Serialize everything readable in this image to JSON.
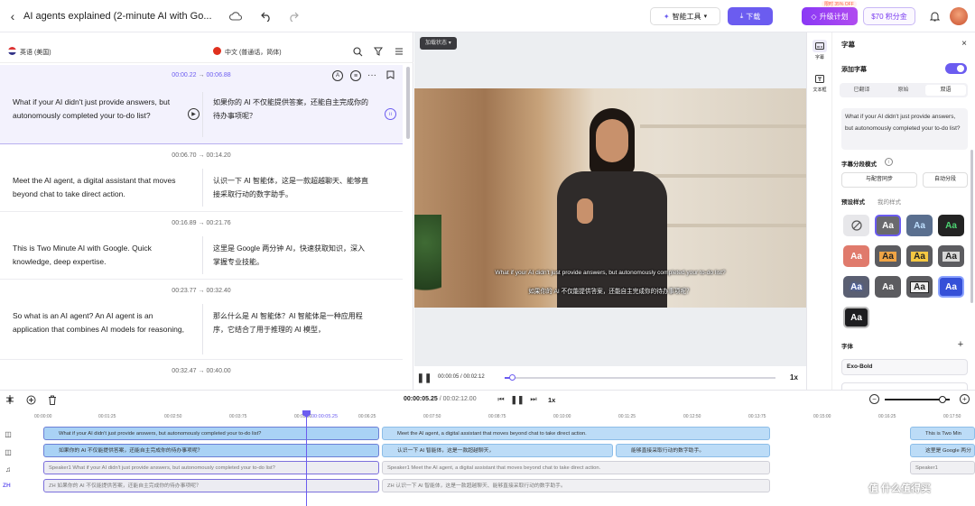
{
  "header": {
    "title": "AI agents explained (2-minute AI with Go...",
    "smart_tools": "智能工具",
    "download": "下载",
    "promo_badge": "限时 35% OFF",
    "upgrade": "升级计划",
    "credits": "$70 积分金"
  },
  "languages": {
    "source": "英语 (美国)",
    "target": "中文 (普通话，简体)"
  },
  "segments": [
    {
      "time_start": "00:00.22",
      "time_end": "00:06.88",
      "en": "What if your AI didn't just provide answers, but autonomously completed your to-do list?",
      "zh": "如果你的 AI 不仅能提供答案，还能自主完成你的待办事项呢？"
    },
    {
      "time_start": "00:06.70",
      "time_end": "00:14.20",
      "en": "Meet the AI agent, a digital assistant that moves beyond chat to take direct action.",
      "zh": "认识一下 AI 智能体，这是一款超越聊天、能够直接采取行动的数字助手。"
    },
    {
      "time_start": "00:16.89",
      "time_end": "00:21.76",
      "en": "This is Two Minute AI with Google. Quick knowledge, deep expertise.",
      "zh": "这里是 Google 两分钟 AI，快速获取知识，深入掌握专业技能。"
    },
    {
      "time_start": "00:23.77",
      "time_end": "00:32.40",
      "en": "So what is an AI agent? An AI agent is an application that combines AI models for reasoning,",
      "zh": "那么什么是 AI 智能体？AI 智能体是一种应用程序，它结合了用于推理的 AI 模型，"
    },
    {
      "time_start": "00:32.47",
      "time_end": "00:40.00",
      "en": "",
      "zh": ""
    }
  ],
  "video": {
    "status": "加载状态",
    "subtitle_en": "What if your AI didn't just provide answers, but autonomously completed your to-do list?",
    "subtitle_zh": "如果你的 AI 不仅能提供答案，还能自主完成你的待办事项呢？",
    "time_current": "00:00:05",
    "time_total": "00:02:12",
    "speed": "1x"
  },
  "rail": {
    "subtitles": "字幕",
    "text": "文本框"
  },
  "panel": {
    "title": "字幕",
    "add_subtitles": "添加字幕",
    "tabs": [
      "已翻译",
      "原始",
      "双语"
    ],
    "preview": "What if your AI didn't just provide answers, but autonomously completed your to-do list?",
    "split_mode_label": "字幕分段模式",
    "split_options": [
      "与配音同步",
      "自动分段"
    ],
    "style_tabs": [
      "预设样式",
      "我的样式"
    ],
    "style_tile_text": "Aa",
    "font_label": "字体",
    "font_value": "Exo-Bold"
  },
  "timeline": {
    "time_current": "00:00:05.25",
    "time_total": "00:02:12.00",
    "speed": "1x",
    "playhead_label": "00:00:05.25",
    "ruler": [
      "00:00:00",
      "00:01:25",
      "00:02:50",
      "00:03:75",
      "00:05:00",
      "00:06:25",
      "00:07:50",
      "00:08:75",
      "00:10:00",
      "00:11:25",
      "00:12:50",
      "00:13:75",
      "00:15:00",
      "00:16:25",
      "00:17:50"
    ],
    "track_zh_label": "ZH",
    "row1": [
      "What if your AI didn't just provide answers, but autonomously completed your to-do list?",
      "Meet the AI agent, a digital assistant that moves beyond chat to take direct action.",
      "This is Two Min"
    ],
    "row2": [
      "如果你的 AI 不仅能提供答案，还能自主完成你的待办事项呢？",
      "认识一下 AI 智能体，这是一款超越聊天，",
      "能够直接采取行动的数字助手。",
      "这里是 Google 两分"
    ],
    "row3": [
      "Speaker1  What if your AI didn't just provide answers, but autonomously completed your to-do list?",
      "Speaker1  Meet the AI agent, a digital assistant that moves beyond chat to take direct action.",
      "Speaker1"
    ],
    "row4": [
      "ZH  如果你的 AI 不仅能提供答案，还能自主完成你的待办事项呢？",
      "ZH  认识一下 AI 智能体，这是一款超越聊天、能够直接采取行动的数字助手。"
    ]
  },
  "watermark": "值 什么值得买",
  "colors": {
    "accent": "#6b5cf0",
    "subtitle_clip": "#bcdcf7",
    "promo": "#7a3cf0"
  }
}
